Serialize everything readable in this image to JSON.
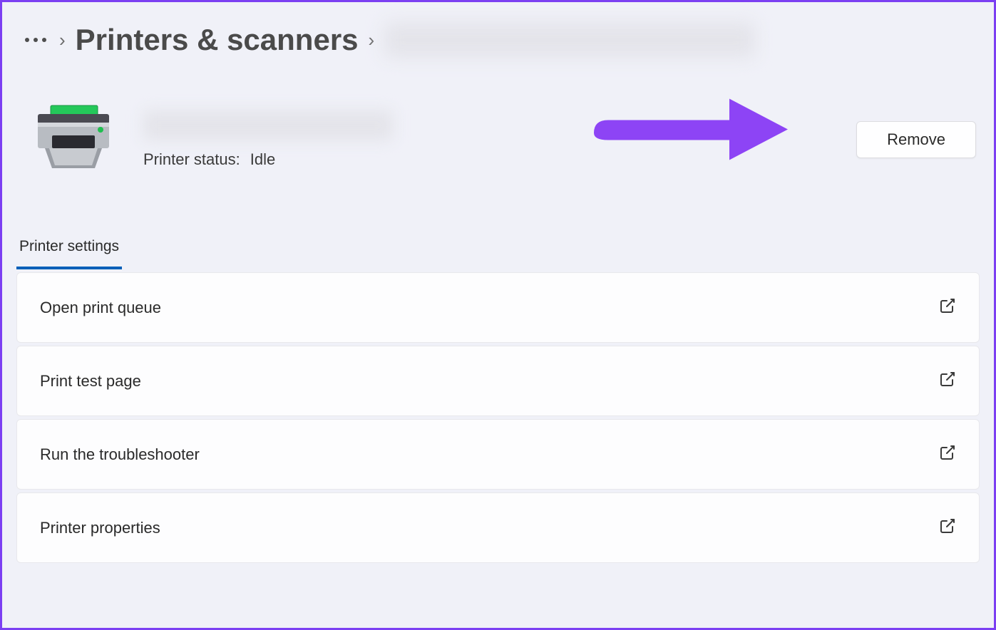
{
  "breadcrumb": {
    "title": "Printers & scanners"
  },
  "printer": {
    "status_label": "Printer status:",
    "status_value": "Idle",
    "remove_button": "Remove"
  },
  "tabs": {
    "active": "Printer settings"
  },
  "settings_items": [
    {
      "label": "Open print queue"
    },
    {
      "label": "Print test page"
    },
    {
      "label": "Run the troubleshooter"
    },
    {
      "label": "Printer properties"
    }
  ]
}
